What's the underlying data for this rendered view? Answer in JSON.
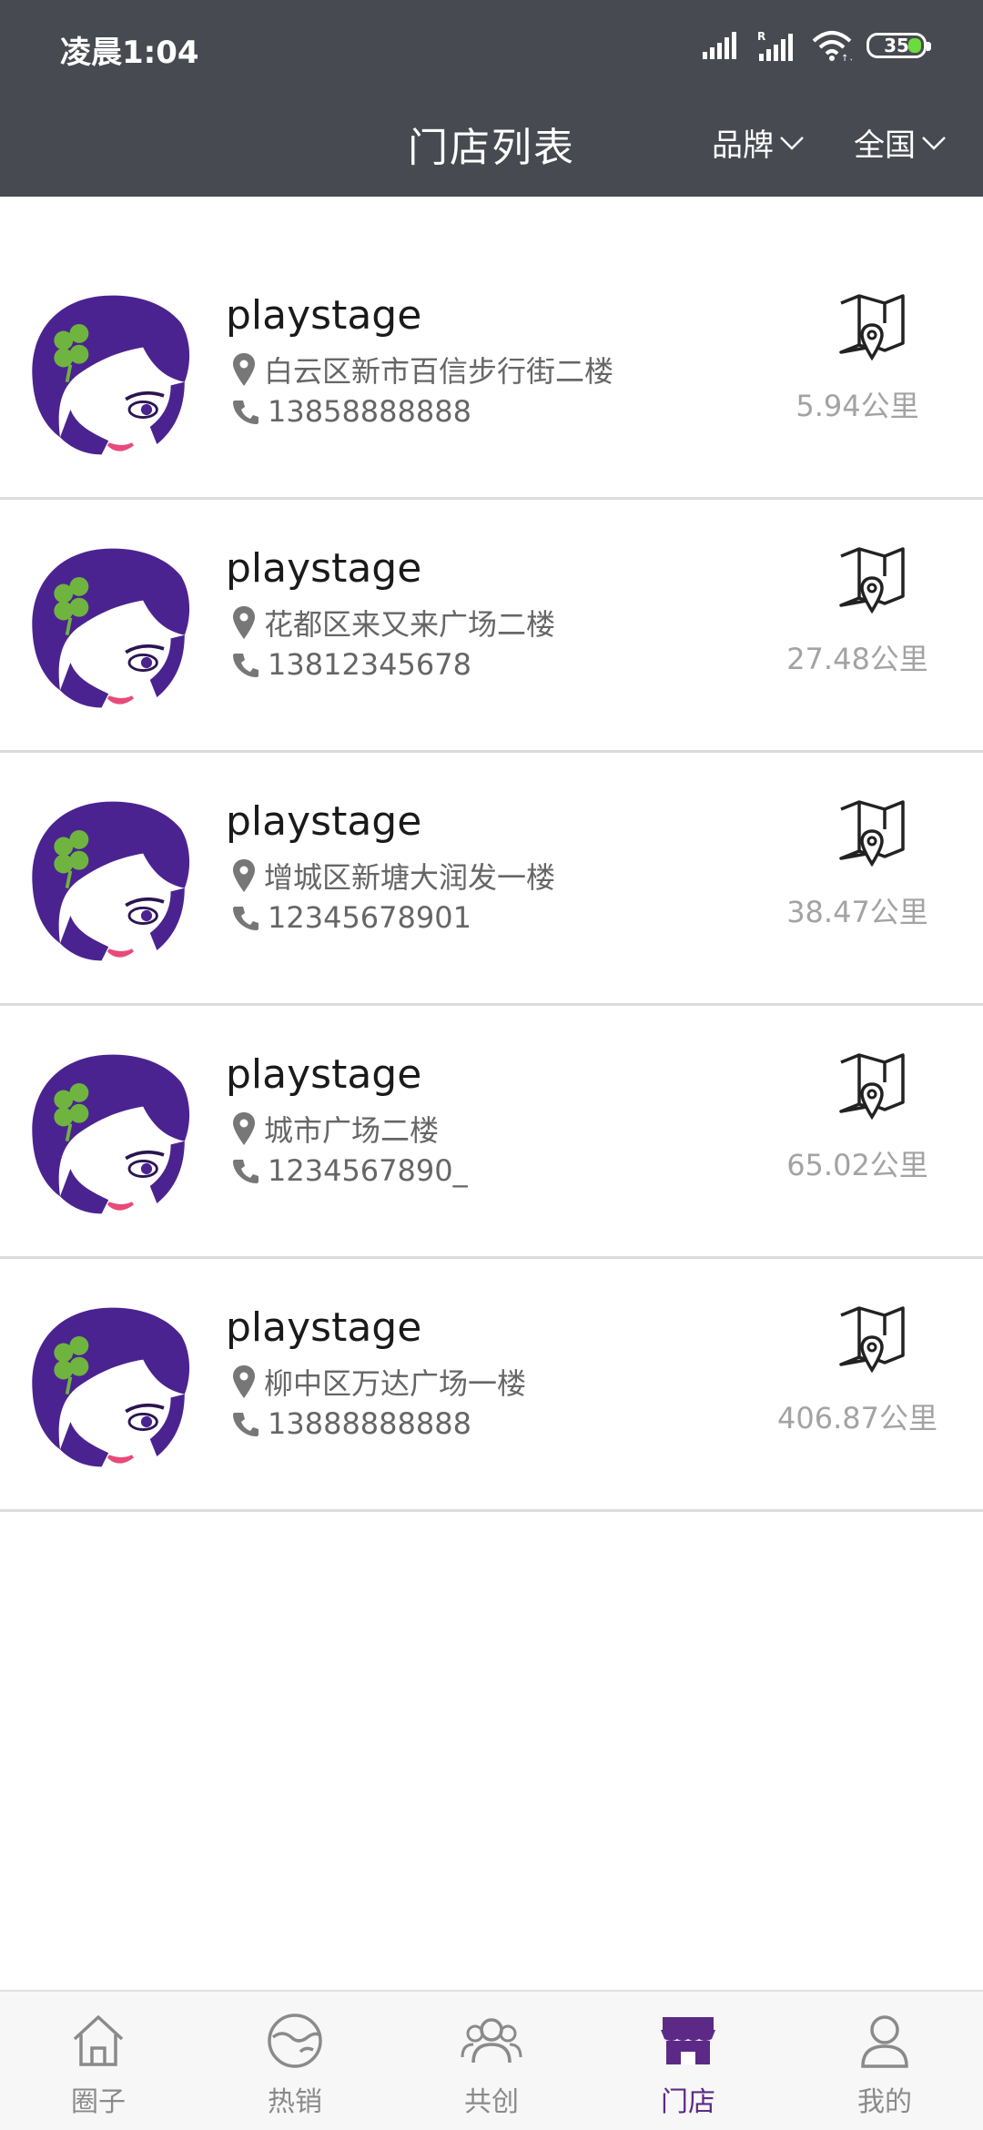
{
  "status_bar": {
    "time": "凌晨1:04",
    "battery": "35",
    "icons": [
      "signal-icon",
      "roaming-signal-icon",
      "wifi-icon",
      "battery-icon"
    ]
  },
  "header": {
    "title": "门店列表",
    "brand_filter": "品牌",
    "region_filter": "全国"
  },
  "stores": [
    {
      "name": "playstage",
      "address": "白云区新市百信步行街二楼",
      "phone": "13858888888",
      "distance": "5.94公里"
    },
    {
      "name": "playstage",
      "address": "花都区来又来广场二楼",
      "phone": "13812345678",
      "distance": "27.48公里"
    },
    {
      "name": "playstage",
      "address": "增城区新塘大润发一楼",
      "phone": "12345678901",
      "distance": "38.47公里"
    },
    {
      "name": "playstage",
      "address": "城市广场二楼",
      "phone": "1234567890_",
      "distance": "65.02公里"
    },
    {
      "name": "playstage",
      "address": "柳中区万达广场一楼",
      "phone": "13888888888",
      "distance": "406.87公里"
    }
  ],
  "tabbar": {
    "items": [
      {
        "label": "圈子",
        "icon": "home-icon"
      },
      {
        "label": "热销",
        "icon": "hot-sale-icon"
      },
      {
        "label": "共创",
        "icon": "people-icon"
      },
      {
        "label": "门店",
        "icon": "store-icon"
      },
      {
        "label": "我的",
        "icon": "profile-icon"
      }
    ],
    "active_index": 3
  },
  "colors": {
    "header_bg": "#474a50",
    "accent": "#5c2a86",
    "avatar_purple": "#4b2390",
    "distance_text": "#a3a3a3"
  }
}
